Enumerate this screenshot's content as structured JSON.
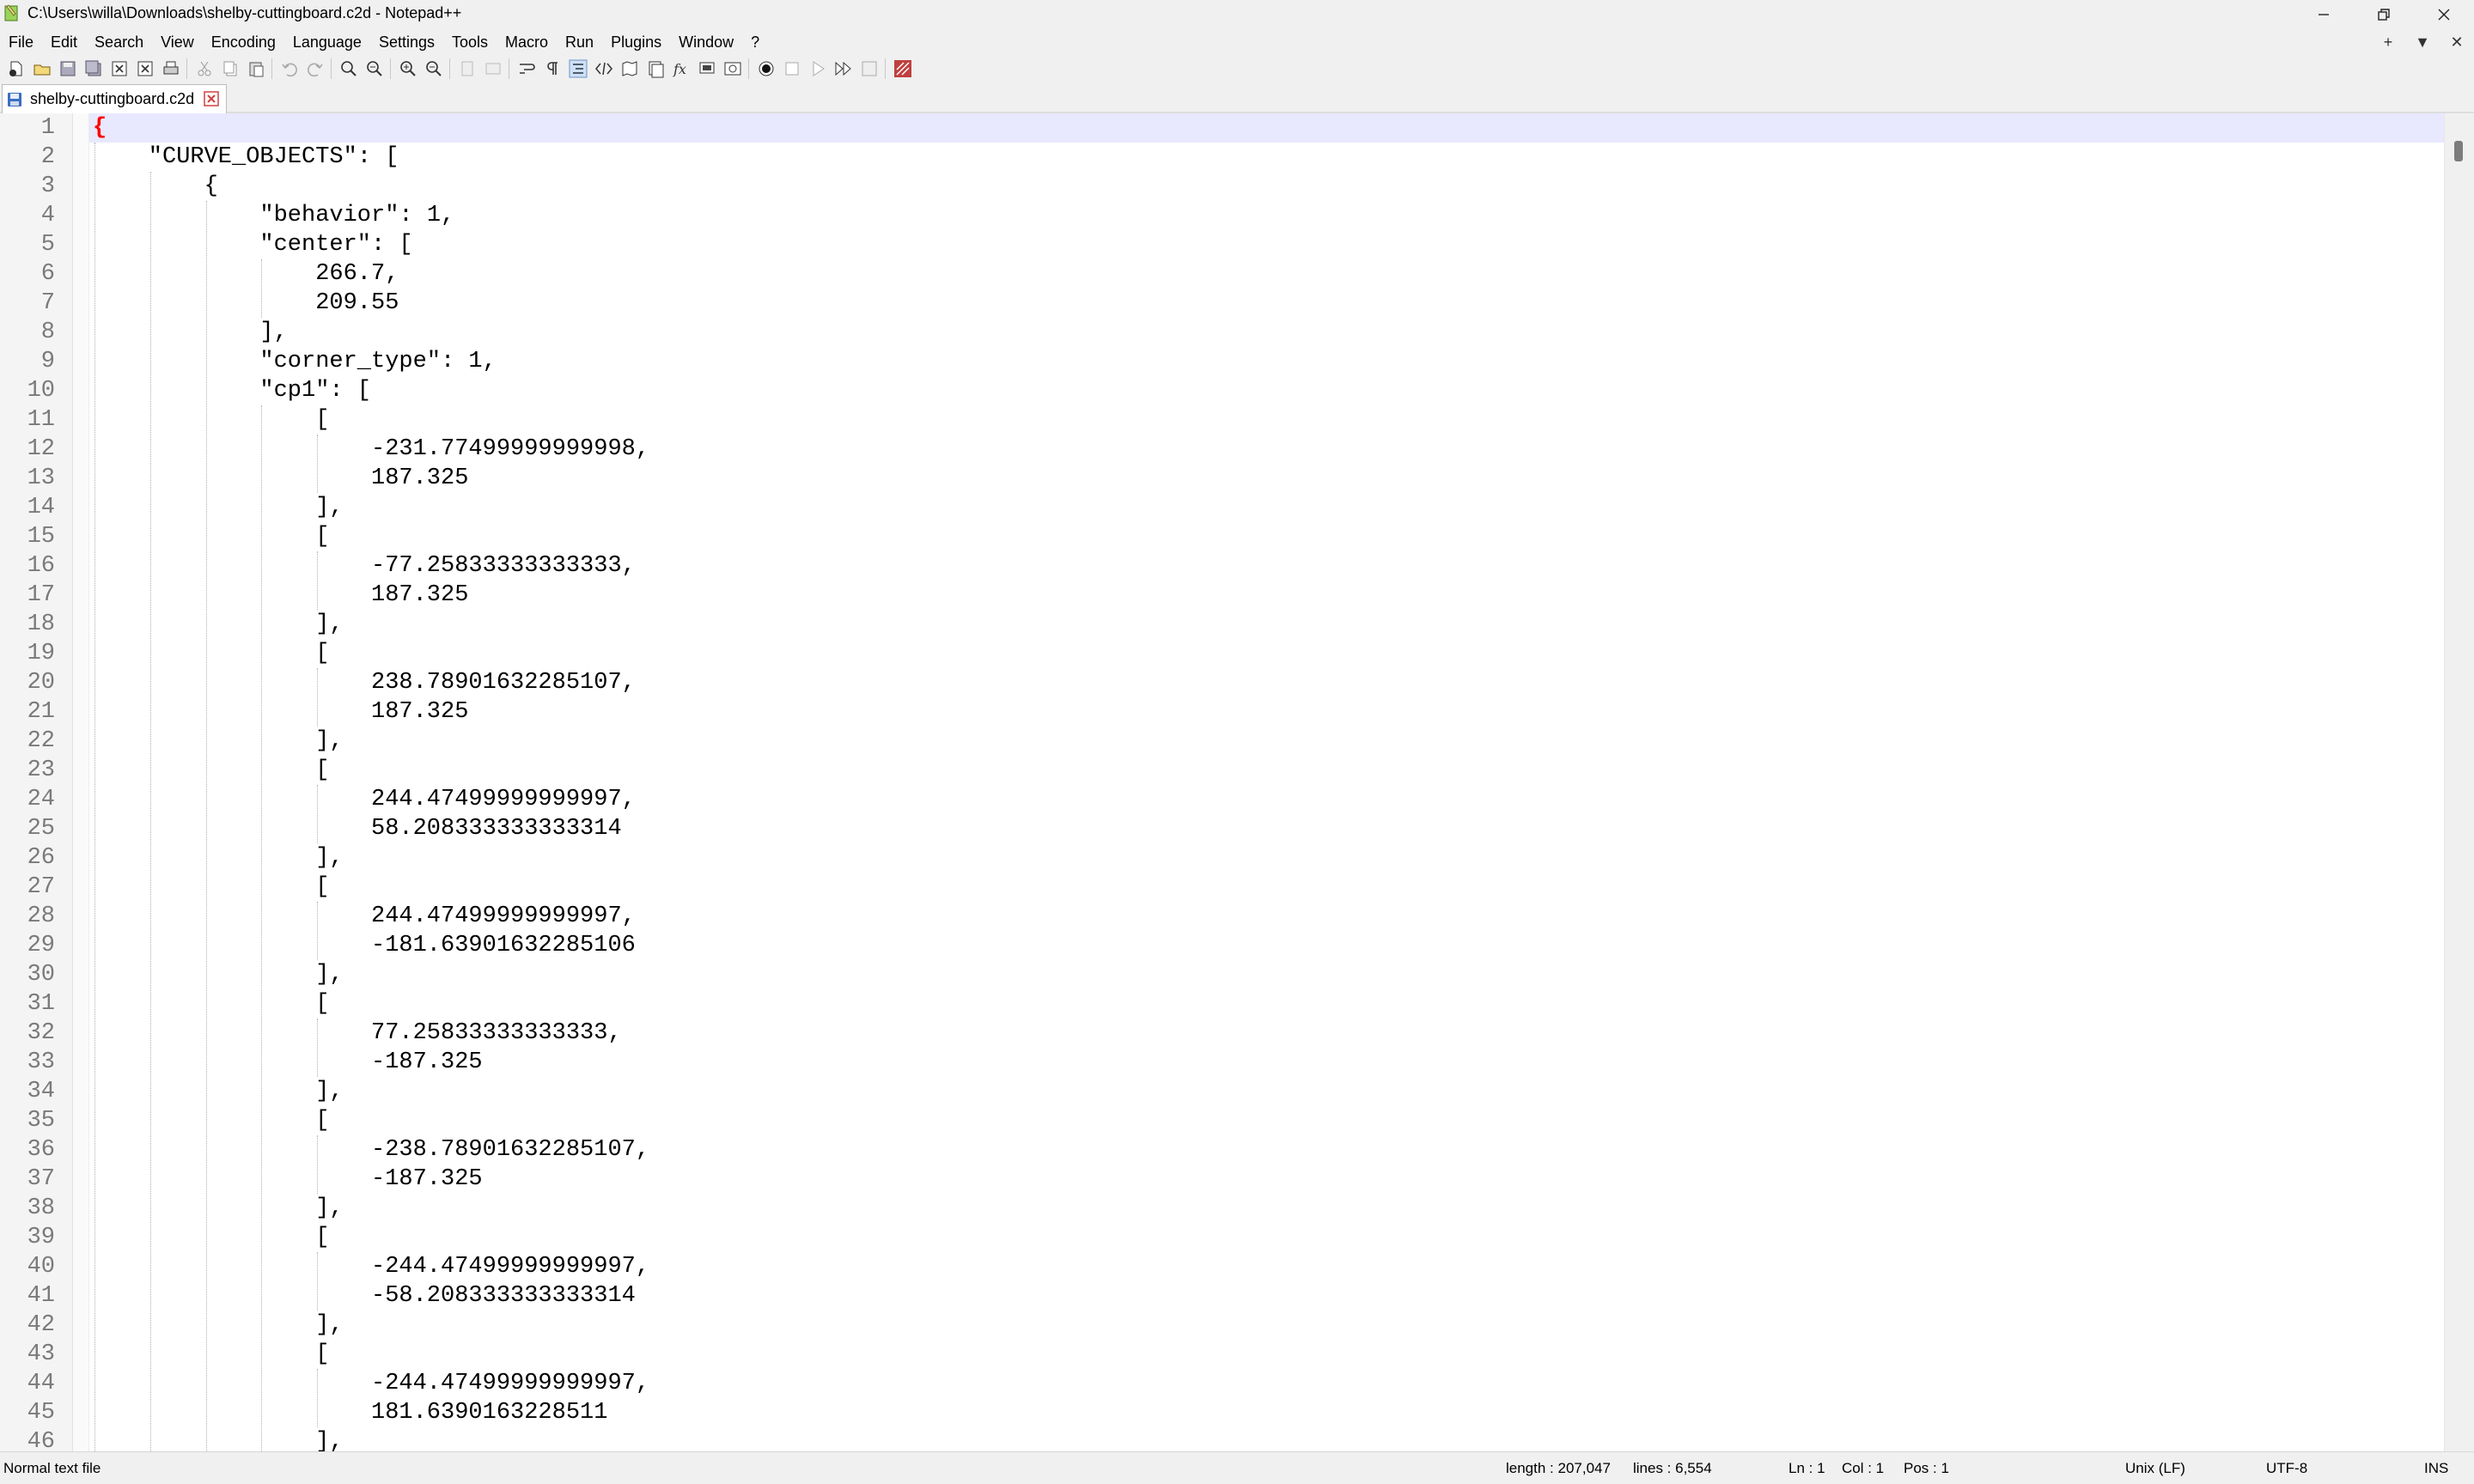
{
  "window": {
    "title": "C:\\Users\\willa\\Downloads\\shelby-cuttingboard.c2d - Notepad++"
  },
  "menu": {
    "items": [
      "File",
      "Edit",
      "Search",
      "View",
      "Encoding",
      "Language",
      "Settings",
      "Tools",
      "Macro",
      "Run",
      "Plugins",
      "Window",
      "?"
    ],
    "right": [
      "+",
      "▼",
      "✕"
    ]
  },
  "toolbar": {
    "icons": [
      "new-file-icon",
      "open-file-icon",
      "save-icon",
      "save-all-icon",
      "close-icon",
      "close-all-icon",
      "print-icon",
      "cut-icon",
      "copy-icon",
      "paste-icon",
      "undo-icon",
      "redo-icon",
      "find-icon",
      "replace-icon",
      "zoom-in-icon",
      "zoom-out-icon",
      "sync-vertical-icon",
      "sync-horizontal-icon",
      "word-wrap-icon",
      "show-all-chars-icon",
      "indent-guide-icon",
      "xml-tag-icon",
      "document-map-icon",
      "doc-list-icon",
      "function-list-icon",
      "folder-workspace-icon",
      "monitoring-icon",
      "record-macro-icon",
      "stop-record-icon",
      "play-macro-icon",
      "run-macro-multiple-icon",
      "save-macro-icon",
      "spell-check-icon"
    ]
  },
  "tabs": [
    {
      "label": "shelby-cuttingboard.c2d",
      "active": true
    }
  ],
  "editor": {
    "lines": [
      {
        "n": "1",
        "indent": 0,
        "text": "{",
        "brace": true
      },
      {
        "n": "2",
        "indent": 1,
        "text": "\"CURVE_OBJECTS\": ["
      },
      {
        "n": "3",
        "indent": 2,
        "text": "{"
      },
      {
        "n": "4",
        "indent": 3,
        "text": "\"behavior\": 1,"
      },
      {
        "n": "5",
        "indent": 3,
        "text": "\"center\": ["
      },
      {
        "n": "6",
        "indent": 4,
        "text": "266.7,"
      },
      {
        "n": "7",
        "indent": 4,
        "text": "209.55"
      },
      {
        "n": "8",
        "indent": 3,
        "text": "],"
      },
      {
        "n": "9",
        "indent": 3,
        "text": "\"corner_type\": 1,"
      },
      {
        "n": "10",
        "indent": 3,
        "text": "\"cp1\": ["
      },
      {
        "n": "11",
        "indent": 4,
        "text": "["
      },
      {
        "n": "12",
        "indent": 5,
        "text": "-231.77499999999998,"
      },
      {
        "n": "13",
        "indent": 5,
        "text": "187.325"
      },
      {
        "n": "14",
        "indent": 4,
        "text": "],"
      },
      {
        "n": "15",
        "indent": 4,
        "text": "["
      },
      {
        "n": "16",
        "indent": 5,
        "text": "-77.25833333333333,"
      },
      {
        "n": "17",
        "indent": 5,
        "text": "187.325"
      },
      {
        "n": "18",
        "indent": 4,
        "text": "],"
      },
      {
        "n": "19",
        "indent": 4,
        "text": "["
      },
      {
        "n": "20",
        "indent": 5,
        "text": "238.78901632285107,"
      },
      {
        "n": "21",
        "indent": 5,
        "text": "187.325"
      },
      {
        "n": "22",
        "indent": 4,
        "text": "],"
      },
      {
        "n": "23",
        "indent": 4,
        "text": "["
      },
      {
        "n": "24",
        "indent": 5,
        "text": "244.47499999999997,"
      },
      {
        "n": "25",
        "indent": 5,
        "text": "58.208333333333314"
      },
      {
        "n": "26",
        "indent": 4,
        "text": "],"
      },
      {
        "n": "27",
        "indent": 4,
        "text": "["
      },
      {
        "n": "28",
        "indent": 5,
        "text": "244.47499999999997,"
      },
      {
        "n": "29",
        "indent": 5,
        "text": "-181.63901632285106"
      },
      {
        "n": "30",
        "indent": 4,
        "text": "],"
      },
      {
        "n": "31",
        "indent": 4,
        "text": "["
      },
      {
        "n": "32",
        "indent": 5,
        "text": "77.25833333333333,"
      },
      {
        "n": "33",
        "indent": 5,
        "text": "-187.325"
      },
      {
        "n": "34",
        "indent": 4,
        "text": "],"
      },
      {
        "n": "35",
        "indent": 4,
        "text": "["
      },
      {
        "n": "36",
        "indent": 5,
        "text": "-238.78901632285107,"
      },
      {
        "n": "37",
        "indent": 5,
        "text": "-187.325"
      },
      {
        "n": "38",
        "indent": 4,
        "text": "],"
      },
      {
        "n": "39",
        "indent": 4,
        "text": "["
      },
      {
        "n": "40",
        "indent": 5,
        "text": "-244.47499999999997,"
      },
      {
        "n": "41",
        "indent": 5,
        "text": "-58.208333333333314"
      },
      {
        "n": "42",
        "indent": 4,
        "text": "],"
      },
      {
        "n": "43",
        "indent": 4,
        "text": "["
      },
      {
        "n": "44",
        "indent": 5,
        "text": "-244.47499999999997,"
      },
      {
        "n": "45",
        "indent": 5,
        "text": "181.6390163228511"
      },
      {
        "n": "46",
        "indent": 4,
        "text": "],"
      }
    ]
  },
  "status": {
    "file_type": "Normal text file",
    "length": "length : 207,047",
    "lines": "lines : 6,554",
    "ln": "Ln : 1",
    "col": "Col : 1",
    "pos": "Pos : 1",
    "eol": "Unix (LF)",
    "encoding": "UTF-8",
    "mode": "INS"
  }
}
